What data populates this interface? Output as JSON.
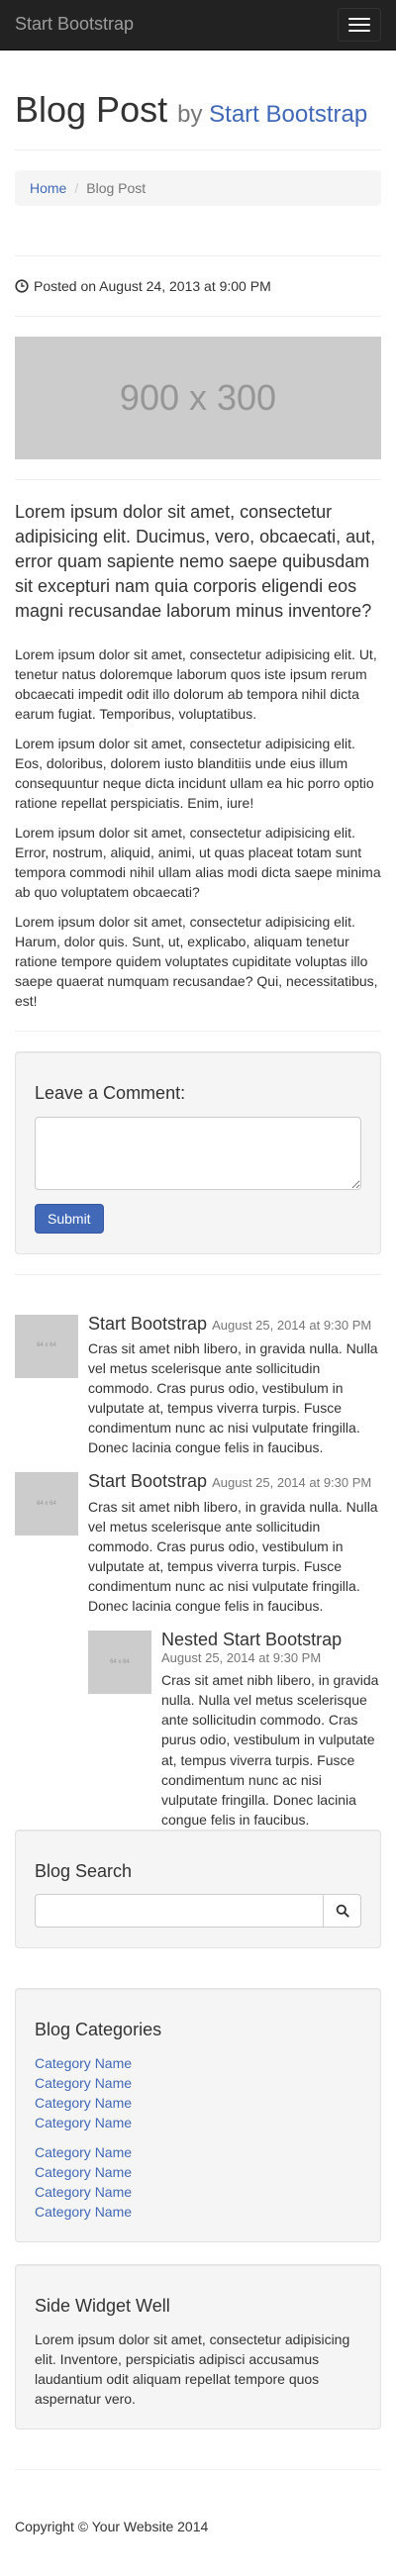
{
  "navbar": {
    "brand": "Start Bootstrap"
  },
  "post": {
    "title": "Blog Post",
    "by": "by",
    "author": "Start Bootstrap",
    "posted": "Posted on August 24, 2013 at 9:00 PM",
    "image_label": "900 x 300",
    "lead": "Lorem ipsum dolor sit amet, consectetur adipisicing elit. Ducimus, vero, obcaecati, aut, error quam sapiente nemo saepe quibusdam sit excepturi nam quia corporis eligendi eos magni recusandae laborum minus inventore?",
    "paragraphs": [
      "Lorem ipsum dolor sit amet, consectetur adipisicing elit. Ut, tenetur natus doloremque laborum quos iste ipsum rerum obcaecati impedit odit illo dolorum ab tempora nihil dicta earum fugiat. Temporibus, voluptatibus.",
      "Lorem ipsum dolor sit amet, consectetur adipisicing elit. Eos, doloribus, dolorem iusto blanditiis unde eius illum consequuntur neque dicta incidunt ullam ea hic porro optio ratione repellat perspiciatis. Enim, iure!",
      "Lorem ipsum dolor sit amet, consectetur adipisicing elit. Error, nostrum, aliquid, animi, ut quas placeat totam sunt tempora commodi nihil ullam alias modi dicta saepe minima ab quo voluptatem obcaecati?",
      "Lorem ipsum dolor sit amet, consectetur adipisicing elit. Harum, dolor quis. Sunt, ut, explicabo, aliquam tenetur ratione tempore quidem voluptates cupiditate voluptas illo saepe quaerat numquam recusandae? Qui, necessitatibus, est!"
    ]
  },
  "breadcrumb": {
    "home": "Home",
    "current": "Blog Post"
  },
  "comment_form": {
    "title": "Leave a Comment:",
    "submit": "Submit",
    "textarea_value": ""
  },
  "comments": [
    {
      "author": "Start Bootstrap",
      "date": "August 25, 2014 at 9:30 PM",
      "thumb": "64 x 64",
      "text": "Cras sit amet nibh libero, in gravida nulla. Nulla vel metus scelerisque ante sollicitudin commodo. Cras purus odio, vestibulum in vulputate at, tempus viverra turpis. Fusce condimentum nunc ac nisi vulputate fringilla. Donec lacinia congue felis in faucibus."
    },
    {
      "author": "Start Bootstrap",
      "date": "August 25, 2014 at 9:30 PM",
      "thumb": "64 x 64",
      "text": "Cras sit amet nibh libero, in gravida nulla. Nulla vel metus scelerisque ante sollicitudin commodo. Cras purus odio, vestibulum in vulputate at, tempus viverra turpis. Fusce condimentum nunc ac nisi vulputate fringilla. Donec lacinia congue felis in faucibus.",
      "nested": {
        "author": "Nested Start Bootstrap",
        "date": "August 25, 2014 at 9:30 PM",
        "thumb": "64 x 64",
        "text": "Cras sit amet nibh libero, in gravida nulla. Nulla vel metus scelerisque ante sollicitudin commodo. Cras purus odio, vestibulum in vulputate at, tempus viverra turpis. Fusce condimentum nunc ac nisi vulputate fringilla. Donec lacinia congue felis in faucibus."
      }
    }
  ],
  "sidebar": {
    "search": {
      "title": "Blog Search",
      "value": ""
    },
    "categories": {
      "title": "Blog Categories",
      "left": [
        "Category Name",
        "Category Name",
        "Category Name",
        "Category Name"
      ],
      "right": [
        "Category Name",
        "Category Name",
        "Category Name",
        "Category Name"
      ]
    },
    "widget": {
      "title": "Side Widget Well",
      "text": "Lorem ipsum dolor sit amet, consectetur adipisicing elit. Inventore, perspiciatis adipisci accusamus laudantium odit aliquam repellat tempore quos aspernatur vero."
    }
  },
  "footer": {
    "copyright": "Copyright © Your Website 2014"
  },
  "colors": {
    "navbar_bg": "#222222",
    "link": "#4169b8",
    "well_bg": "#f5f5f5",
    "placeholder_bg": "#cccccc"
  },
  "icons": {
    "posted": "clock-icon",
    "search": "search-icon",
    "menu": "hamburger-menu-icon"
  }
}
